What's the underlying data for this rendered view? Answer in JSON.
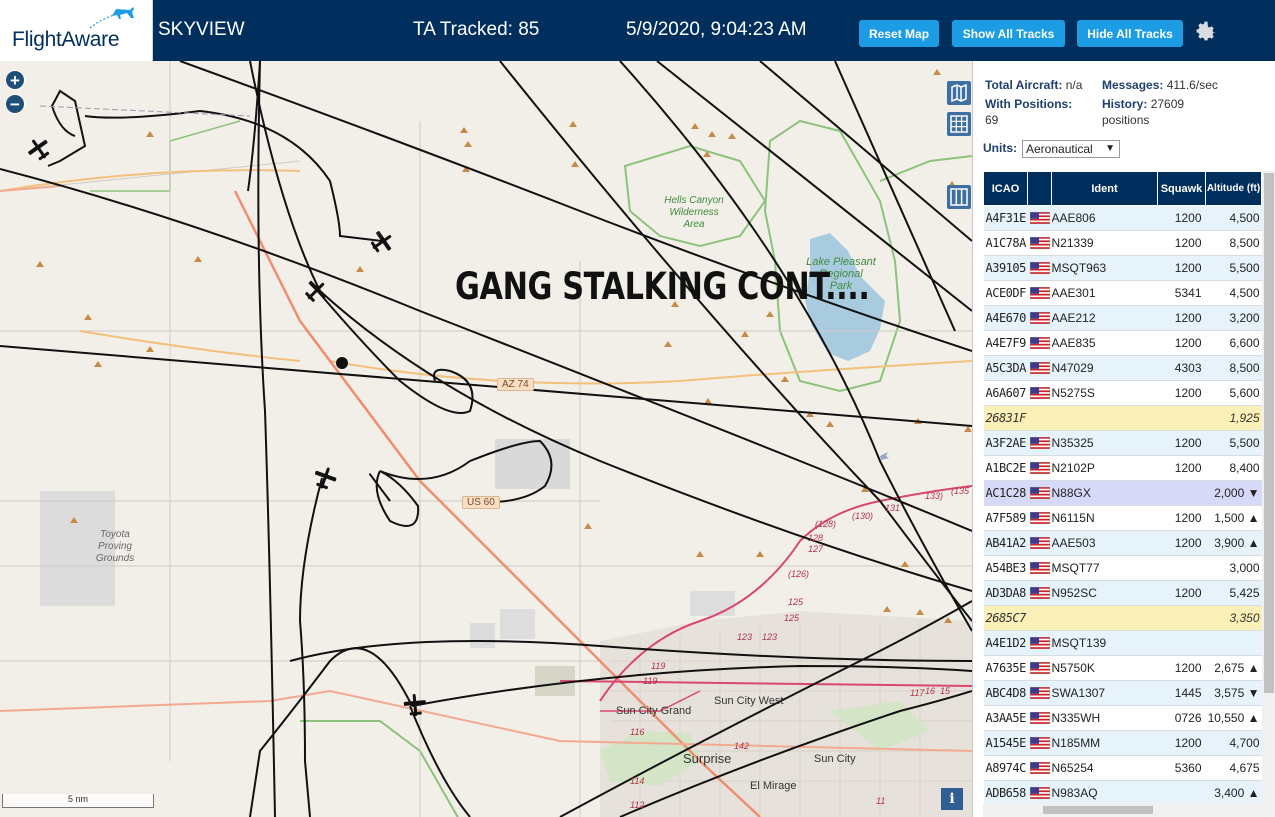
{
  "header": {
    "logo": "FlightAware",
    "app_name": "SKYVIEW",
    "tracked": "TA Tracked: 85",
    "datetime": "5/9/2020, 9:04:23 AM",
    "reset_label": "Reset Map",
    "show_label": "Show All Tracks",
    "hide_label": "Hide All Tracks",
    "settings_icon": "gear-icon",
    "color": "#002f5d",
    "button_color": "#1b9ce3"
  },
  "map": {
    "overlay_text": "GANG STALKING CONT....",
    "scale": "5 nm",
    "zoom_in": "+",
    "zoom_out": "−",
    "info": "i",
    "labels": {
      "hells_canyon": [
        "Hells Canyon",
        "Wilderness",
        "Area"
      ],
      "lake_pleasant": [
        "Lake Pleasant",
        "Regional",
        "Park"
      ],
      "toyota": [
        "Toyota",
        "Proving",
        "Grounds"
      ],
      "az74": "AZ 74",
      "us60": "US 60",
      "sun_city_grand": "Sun City Grand",
      "sun_city_west": "Sun City West",
      "sun_city": "Sun City",
      "surprise": "Surprise",
      "el_mirage": "El Mirage",
      "routes": [
        "(135",
        "133)",
        "131",
        "(130)",
        "(128)",
        "128",
        "127",
        "(126)",
        "125",
        "125",
        "123",
        "123",
        "119",
        "119",
        "117",
        "16",
        "15",
        "116",
        "114",
        "112",
        "142",
        "11"
      ]
    },
    "controls": [
      "map-layers-icon",
      "grid-icon",
      "columns-icon"
    ]
  },
  "panel": {
    "total_label": "Total Aircraft:",
    "total_value": "n/a",
    "messages_label": "Messages:",
    "messages_value": "411.6/sec",
    "positions_label": "With Positions:",
    "positions_value": "69",
    "history_label": "History:",
    "history_value": "27609",
    "history_unit": "positions",
    "units_label": "Units:",
    "units_value": "Aeronautical",
    "columns": [
      "ICAO",
      "",
      "Ident",
      "Squawk",
      "Altitude (ft)"
    ],
    "rows": [
      {
        "icao": "A4F31E",
        "flag": true,
        "ident": "AAE806",
        "squawk": "1200",
        "alt": "4,500",
        "type": "normal"
      },
      {
        "icao": "A1C78A",
        "flag": true,
        "ident": "N21339",
        "squawk": "1200",
        "alt": "8,500",
        "type": "alt"
      },
      {
        "icao": "A39105",
        "flag": true,
        "ident": "MSQT963",
        "squawk": "1200",
        "alt": "5,500",
        "type": "normal"
      },
      {
        "icao": "ACE0DF",
        "flag": true,
        "ident": "AAE301",
        "squawk": "5341",
        "alt": "4,500",
        "type": "alt"
      },
      {
        "icao": "A4E670",
        "flag": true,
        "ident": "AAE212",
        "squawk": "1200",
        "alt": "3,200",
        "type": "normal"
      },
      {
        "icao": "A4E7F9",
        "flag": true,
        "ident": "AAE835",
        "squawk": "1200",
        "alt": "6,600",
        "type": "alt"
      },
      {
        "icao": "A5C3DA",
        "flag": true,
        "ident": "N47029",
        "squawk": "4303",
        "alt": "8,500",
        "type": "normal"
      },
      {
        "icao": "A6A607",
        "flag": true,
        "ident": "N5275S",
        "squawk": "1200",
        "alt": "5,600",
        "type": "alt"
      },
      {
        "icao": "26831F",
        "flag": false,
        "ident": "",
        "squawk": "",
        "alt": "1,925",
        "type": "mlat"
      },
      {
        "icao": "A3F2AE",
        "flag": true,
        "ident": "N35325",
        "squawk": "1200",
        "alt": "5,500",
        "type": "normal"
      },
      {
        "icao": "A1BC2E",
        "flag": true,
        "ident": "N2102P",
        "squawk": "1200",
        "alt": "8,400",
        "type": "alt"
      },
      {
        "icao": "AC1C28",
        "flag": true,
        "ident": "N88GX",
        "squawk": "",
        "alt": "2,000 ▼",
        "type": "selected"
      },
      {
        "icao": "A7F589",
        "flag": true,
        "ident": "N6115N",
        "squawk": "1200",
        "alt": "1,500 ▲",
        "type": "alt"
      },
      {
        "icao": "AB41A2",
        "flag": true,
        "ident": "AAE503",
        "squawk": "1200",
        "alt": "3,900 ▲",
        "type": "normal"
      },
      {
        "icao": "A54BE3",
        "flag": true,
        "ident": "MSQT77",
        "squawk": "",
        "alt": "3,000",
        "type": "alt"
      },
      {
        "icao": "AD3DA8",
        "flag": true,
        "ident": "N952SC",
        "squawk": "1200",
        "alt": "5,425",
        "type": "normal"
      },
      {
        "icao": "2685C7",
        "flag": false,
        "ident": "",
        "squawk": "",
        "alt": "3,350",
        "type": "mlat"
      },
      {
        "icao": "A4E1D2",
        "flag": true,
        "ident": "MSQT139",
        "squawk": "",
        "alt": "",
        "type": "normal"
      },
      {
        "icao": "A7635E",
        "flag": true,
        "ident": "N5750K",
        "squawk": "1200",
        "alt": "2,675 ▲",
        "type": "alt"
      },
      {
        "icao": "ABC4D8",
        "flag": true,
        "ident": "SWA1307",
        "squawk": "1445",
        "alt": "3,575 ▼",
        "type": "normal"
      },
      {
        "icao": "A3AA5E",
        "flag": true,
        "ident": "N335WH",
        "squawk": "0726",
        "alt": "10,550 ▲",
        "type": "alt"
      },
      {
        "icao": "A1545E",
        "flag": true,
        "ident": "N185MM",
        "squawk": "1200",
        "alt": "4,700",
        "type": "normal"
      },
      {
        "icao": "A8974C",
        "flag": true,
        "ident": "N65254",
        "squawk": "5360",
        "alt": "4,675",
        "type": "alt"
      },
      {
        "icao": "ADB658",
        "flag": true,
        "ident": "N983AQ",
        "squawk": "",
        "alt": "3,400 ▲",
        "type": "normal"
      }
    ]
  }
}
